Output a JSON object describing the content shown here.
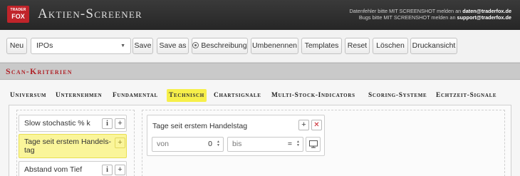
{
  "header": {
    "logo_top": "TRADER",
    "logo_bottom": "FOX",
    "title": "Aktien-Screener",
    "info_line1_prefix": "Datenfehler bitte MIT SCREENSHOT melden an ",
    "info_line1_email": "daten@traderfox.de",
    "info_line2_prefix": "Bugs bitte MIT SCREENSHOT melden an ",
    "info_line2_email": "support@traderfox.de"
  },
  "toolbar": {
    "neu_label": "Neu",
    "select_value": "IPOs",
    "save_label": "Save",
    "save_as_label": "Save as",
    "beschreibung_label": "Beschreibung",
    "umbenennen_label": "Umbenennen",
    "templates_label": "Templates",
    "reset_label": "Reset",
    "loeschen_label": "Löschen",
    "druckansicht_label": "Druckansicht"
  },
  "section": {
    "title": "Scan-Kriterien"
  },
  "tabs": [
    {
      "label": "Universum"
    },
    {
      "label": "Unternehmen"
    },
    {
      "label": "Fundamental"
    },
    {
      "label": "Technisch",
      "active": true
    },
    {
      "label": "Chartsignale"
    },
    {
      "label": "Multi-Stock-Indicators"
    },
    {
      "label": "Scoring-Systeme"
    },
    {
      "label": "Echtzeit-Signale"
    }
  ],
  "criteria": [
    {
      "label": "Slow stochastic % k"
    },
    {
      "label_line1": "Tage seit erstem Handels-",
      "label_line2": "tag"
    },
    {
      "label": "Abstand vom Tief"
    }
  ],
  "filter_card": {
    "title": "Tage seit erstem Handelstag",
    "from_placeholder": "von",
    "from_value": "0",
    "to_placeholder": "bis",
    "to_value": "="
  },
  "colors": {
    "brand_red": "#c0242a",
    "highlight_yellow": "#f6ef4a",
    "header_dark": "#2e2e2e"
  },
  "icons": [
    "info-icon",
    "plus-icon",
    "close-icon",
    "calendar-icon",
    "eye-icon",
    "chevron-down-icon"
  ]
}
